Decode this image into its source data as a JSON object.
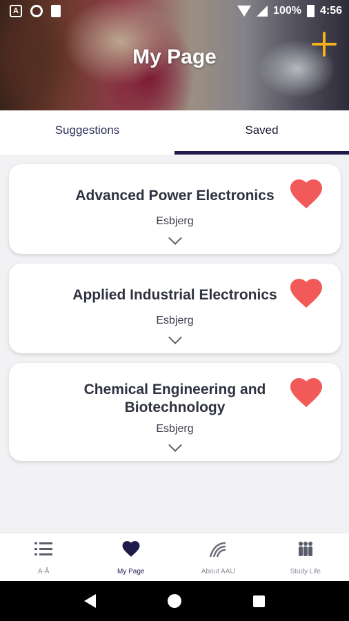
{
  "status_bar": {
    "battery": "100%",
    "time": "4:56"
  },
  "header": {
    "title": "My Page"
  },
  "tabs": [
    {
      "label": "Suggestions",
      "active": false
    },
    {
      "label": "Saved",
      "active": true
    }
  ],
  "cards": [
    {
      "title": "Advanced Power Electronics",
      "location": "Esbjerg",
      "saved": true
    },
    {
      "title": "Applied Industrial Electronics",
      "location": "Esbjerg",
      "saved": true
    },
    {
      "title": "Chemical Engineering and Biotechnology",
      "location": "Esbjerg",
      "saved": true
    }
  ],
  "bottom_nav": [
    {
      "label": "A-Å",
      "icon": "list-icon",
      "active": false
    },
    {
      "label": "My Page",
      "icon": "heart-icon",
      "active": true
    },
    {
      "label": "About AAU",
      "icon": "aau-logo-icon",
      "active": false
    },
    {
      "label": "Study Life",
      "icon": "people-icon",
      "active": false
    }
  ],
  "colors": {
    "accent_navy": "#1e1b4b",
    "heart_red": "#f25a5a",
    "add_yellow": "#f5b21a"
  }
}
